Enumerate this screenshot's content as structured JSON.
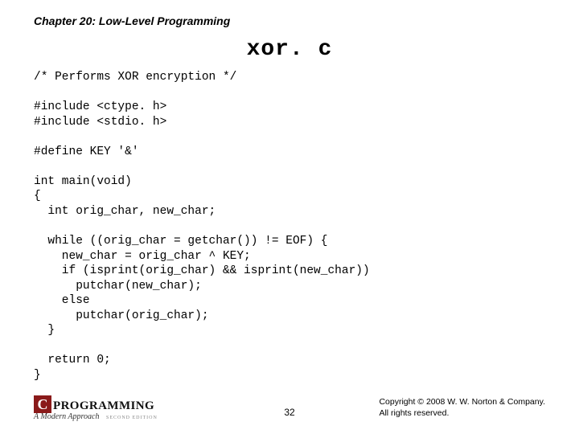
{
  "chapter": "Chapter 20: Low-Level Programming",
  "filename": "xor. c",
  "code": "/* Performs XOR encryption */\n\n#include <ctype. h>\n#include <stdio. h>\n\n#define KEY '&'\n\nint main(void)\n{\n  int orig_char, new_char;\n\n  while ((orig_char = getchar()) != EOF) {\n    new_char = orig_char ^ KEY;\n    if (isprint(orig_char) && isprint(new_char))\n      putchar(new_char);\n    else\n      putchar(orig_char);\n  }\n\n  return 0;\n}",
  "page_number": "32",
  "logo": {
    "c": "C",
    "text": "PROGRAMMING",
    "sub": "A Modern Approach",
    "edition": "SECOND EDITION"
  },
  "copyright_line1": "Copyright © 2008 W. W. Norton & Company.",
  "copyright_line2": "All rights reserved."
}
